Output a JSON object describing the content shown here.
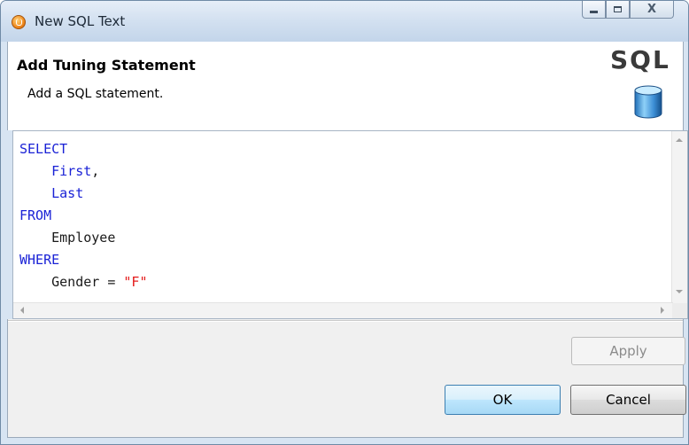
{
  "window": {
    "title": "New SQL Text",
    "controls": {
      "minimize": "minimize",
      "maximize": "maximize",
      "close": "X"
    }
  },
  "header": {
    "title": "Add Tuning Statement",
    "description": "Add a SQL statement.",
    "logo_text": "SQL",
    "logo_icon": "database-cylinder-icon"
  },
  "editor": {
    "lines": [
      {
        "indent": "",
        "tokens": [
          {
            "t": "SELECT",
            "k": "kw"
          }
        ]
      },
      {
        "indent": "    ",
        "tokens": [
          {
            "t": "First",
            "k": "col"
          },
          {
            "t": ",",
            "k": "plain"
          }
        ]
      },
      {
        "indent": "    ",
        "tokens": [
          {
            "t": "Last",
            "k": "col"
          }
        ]
      },
      {
        "indent": "",
        "tokens": [
          {
            "t": "FROM",
            "k": "kw"
          }
        ]
      },
      {
        "indent": "    ",
        "tokens": [
          {
            "t": "Employee",
            "k": "plain"
          }
        ]
      },
      {
        "indent": "",
        "tokens": [
          {
            "t": "WHERE",
            "k": "kw"
          }
        ]
      },
      {
        "indent": "    ",
        "tokens": [
          {
            "t": "Gender = ",
            "k": "plain"
          },
          {
            "t": "\"F\"",
            "k": "str"
          }
        ]
      }
    ]
  },
  "buttons": {
    "apply": "Apply",
    "ok": "OK",
    "cancel": "Cancel"
  },
  "colors": {
    "keyword": "#1a22d6",
    "string": "#e41b1b",
    "title_bar": "#d2e0f0",
    "ok_button": "#bee6fd"
  }
}
